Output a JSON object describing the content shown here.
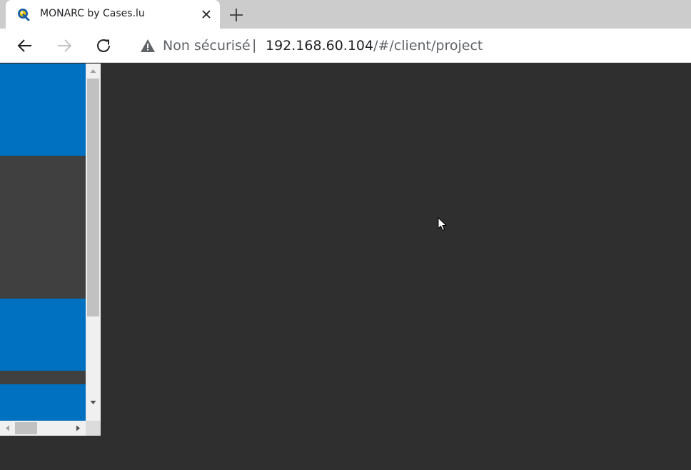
{
  "browser": {
    "tab": {
      "title": "MONARC by Cases.lu",
      "favicon": "monarc-logo-icon"
    },
    "toolbar": {
      "back": "back-arrow-icon",
      "forward": "forward-arrow-icon",
      "reload": "reload-icon"
    },
    "address_bar": {
      "security_label": "Non sécurisé",
      "separator": "|",
      "url_host": "192.168.60.104",
      "url_path": "/#/client/project"
    }
  },
  "page": {
    "background": "#2f2f2f",
    "frame_colors": {
      "blue": "#0070c0",
      "gray": "#404040"
    }
  }
}
